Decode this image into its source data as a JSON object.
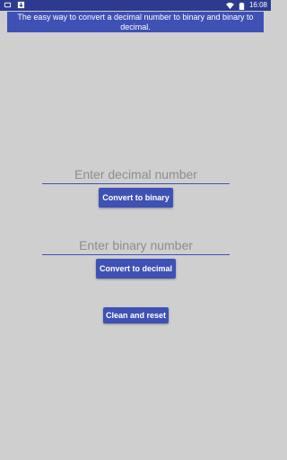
{
  "status_bar": {
    "time": "16:08",
    "icons": [
      "notification-icon",
      "download-icon",
      "wifi-icon",
      "battery-icon"
    ],
    "color": "#2c3a8f"
  },
  "header": {
    "text": "The easy way to convert a decimal number to binary and binary to decimal.",
    "color": "#3f51b5"
  },
  "decimal_input": {
    "placeholder": "Enter decimal number",
    "value": ""
  },
  "binary_input": {
    "placeholder": "Enter binary number",
    "value": ""
  },
  "buttons": {
    "convert_to_binary": "Convert to binary",
    "convert_to_decimal": "Convert to decimal",
    "clean_and_reset": "Clean and reset"
  },
  "theme": {
    "accent": "#3f51b5",
    "background": "#cfcfcf"
  }
}
